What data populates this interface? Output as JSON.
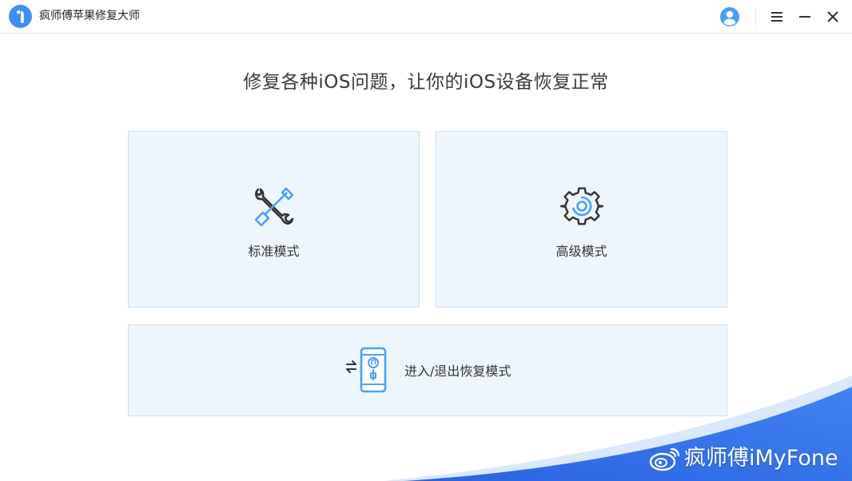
{
  "app": {
    "title": "疯师傅苹果修复大师"
  },
  "titlebar": {
    "icons": [
      "app-logo",
      "account-icon",
      "menu-icon",
      "minimize-icon",
      "close-icon"
    ]
  },
  "main": {
    "headline": "修复各种iOS问题，让你的iOS设备恢复正常",
    "modes": [
      {
        "label": "标准模式",
        "icon": "repair-tools-icon"
      },
      {
        "label": "高级模式",
        "icon": "gear-icon"
      },
      {
        "label": "进入/退出恢复模式",
        "icon": "phone-recovery-icon"
      }
    ]
  },
  "watermark": {
    "text": "疯师傅iMyFone",
    "icon": "weibo-icon"
  },
  "colors": {
    "accent": "#3d8ff0",
    "card_bg": "#eef6fd",
    "card_border": "#cfe0ee",
    "icon_blue": "#4a9ff5",
    "icon_dark": "#333333",
    "wave_blue": "#2f6ee6"
  }
}
